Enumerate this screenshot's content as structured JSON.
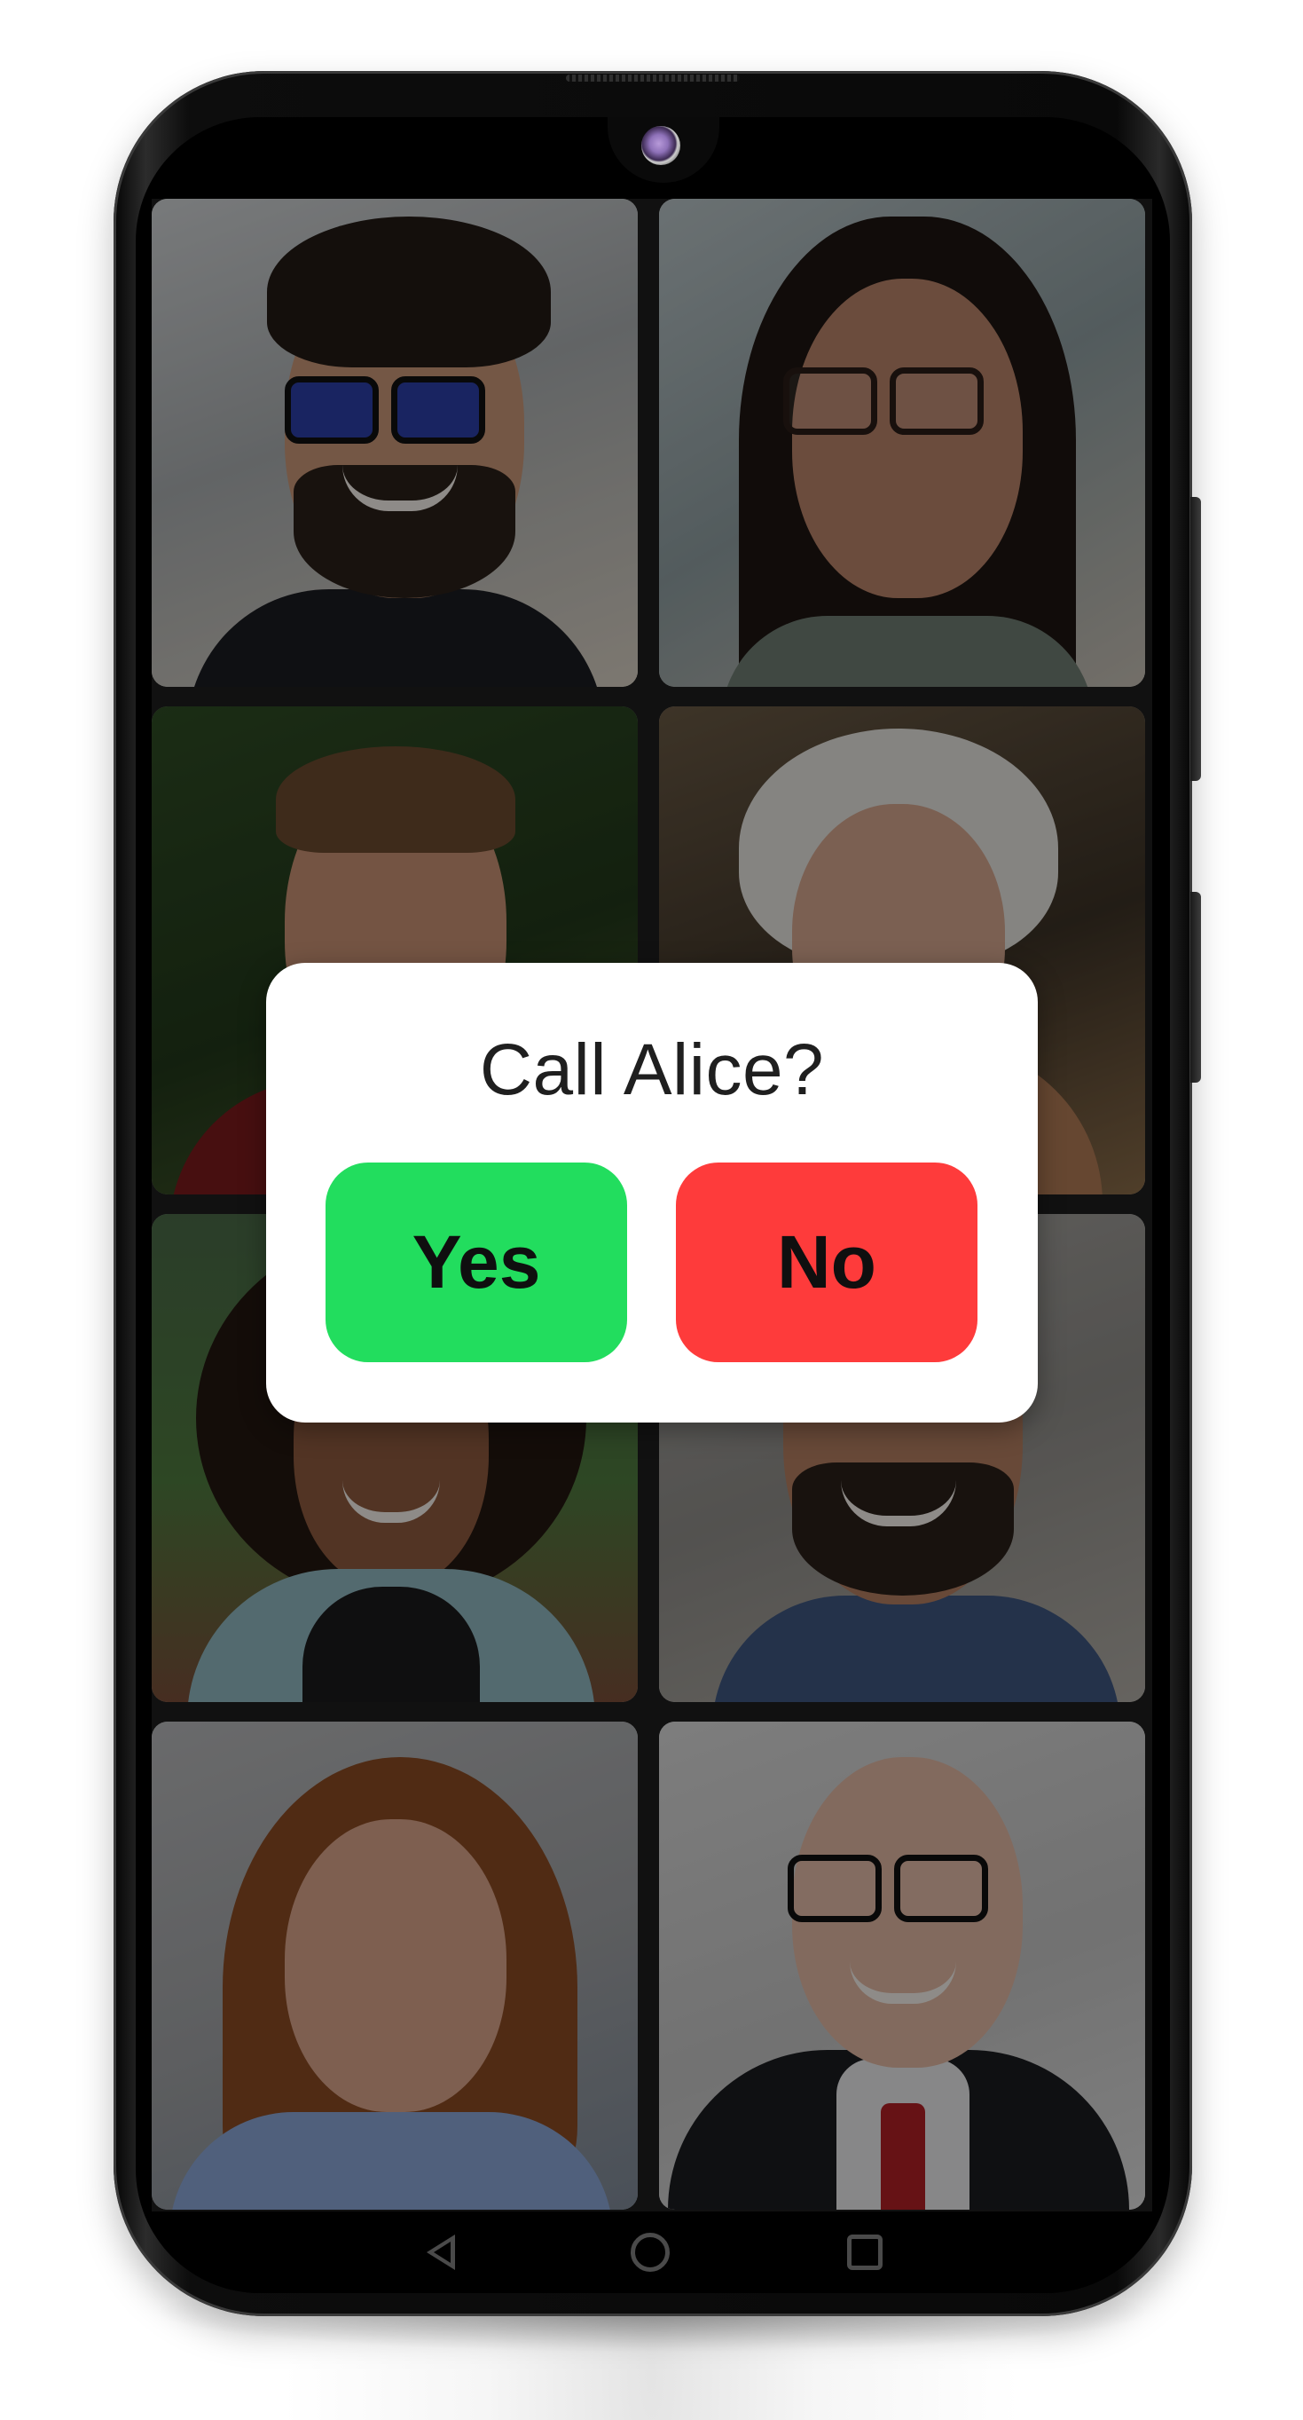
{
  "dialog": {
    "title": "Call Alice?",
    "yes_label": "Yes",
    "no_label": "No",
    "yes_color": "#22dd5e",
    "no_color": "#fe3b3b"
  },
  "contacts": [
    {
      "icon": "contact-photo-man-sunglasses"
    },
    {
      "icon": "contact-photo-woman-glasses"
    },
    {
      "icon": "contact-photo-man-short-hair"
    },
    {
      "icon": "contact-photo-older-woman"
    },
    {
      "icon": "contact-photo-woman-curly-hair"
    },
    {
      "icon": "contact-photo-man-beard"
    },
    {
      "icon": "contact-photo-woman-red-hair"
    },
    {
      "icon": "contact-photo-older-man-glasses"
    }
  ],
  "navigation": {
    "back_icon": "back-triangle-icon",
    "home_icon": "home-circle-icon",
    "recents_icon": "recents-square-icon"
  }
}
